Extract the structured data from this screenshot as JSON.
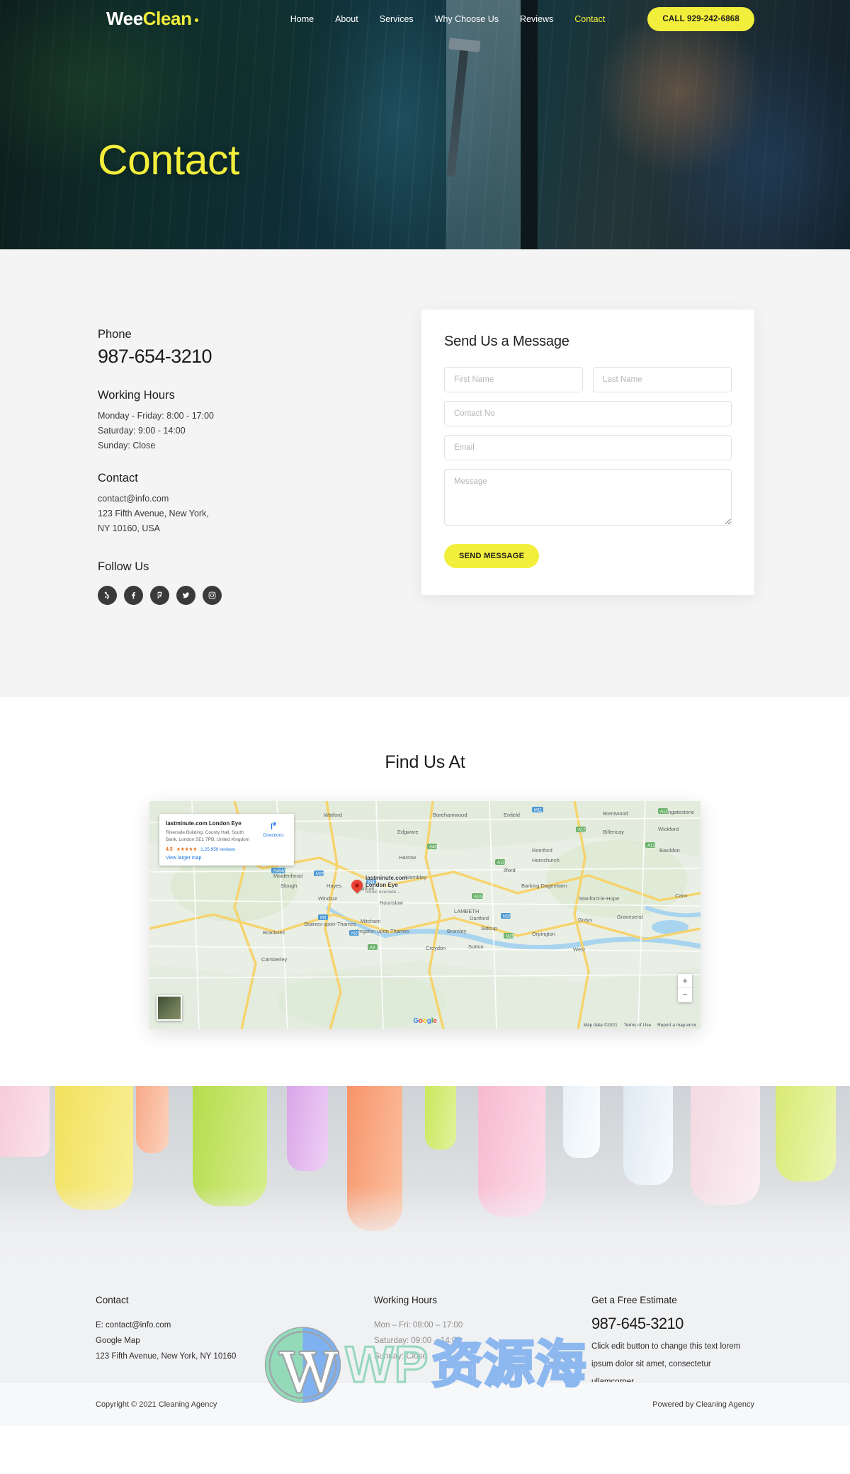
{
  "brand": {
    "name_part1": "Wee",
    "name_part2": "Clean"
  },
  "nav": {
    "items": [
      {
        "label": "Home",
        "active": false
      },
      {
        "label": "About",
        "active": false
      },
      {
        "label": "Services",
        "active": false
      },
      {
        "label": "Why Choose Us",
        "active": false
      },
      {
        "label": "Reviews",
        "active": false
      },
      {
        "label": "Contact",
        "active": true
      }
    ],
    "cta_label": "CALL 929-242-6868"
  },
  "hero": {
    "title": "Contact"
  },
  "contact": {
    "phone_label": "Phone",
    "phone_number": "987-654-3210",
    "hours_label": "Working Hours",
    "hours": [
      "Monday - Friday: 8:00 - 17:00",
      "Saturday: 9:00 - 14:00",
      "Sunday: Close"
    ],
    "contact_label": "Contact",
    "contact_lines": [
      "contact@info.com",
      "123 Fifth Avenue, New York,",
      "NY 10160, USA"
    ],
    "follow_label": "Follow Us",
    "socials": [
      {
        "name": "yelp-icon"
      },
      {
        "name": "facebook-icon"
      },
      {
        "name": "foursquare-icon"
      },
      {
        "name": "twitter-icon"
      },
      {
        "name": "instagram-icon"
      }
    ]
  },
  "form": {
    "title": "Send Us a Message",
    "first_name_placeholder": "First Name",
    "last_name_placeholder": "Last Name",
    "contact_no_placeholder": "Contact No",
    "email_placeholder": "Email",
    "message_placeholder": "Message",
    "first_name_value": "",
    "last_name_value": "",
    "contact_no_value": "",
    "email_value": "",
    "message_value": "",
    "submit_label": "SEND MESSAGE"
  },
  "map": {
    "heading": "Find Us At",
    "card_title": "lastminute.com London Eye",
    "card_address": "Riverside Building, County Hall, South Bank, London SE1 7PB, United Kingdom",
    "rating": "4.5",
    "stars": "★★★★★",
    "reviews": "1,25,959 reviews",
    "view_larger": "View larger map",
    "directions_label": "Directions",
    "marker_title_line1": "lastminute.com",
    "marker_title_line2": "London Eye",
    "marker_subtitle": "Iconic riverside…",
    "zoom_in": "+",
    "zoom_out": "−",
    "attribution": [
      "Map data ©2021",
      "Terms of Use",
      "Report a map error"
    ],
    "google_letters": [
      "G",
      "o",
      "o",
      "g",
      "l",
      "e"
    ]
  },
  "footer": {
    "col1": {
      "heading": "Contact",
      "lines": [
        "E: contact@info.com",
        "Google Map",
        "123 Fifth Avenue, New York, NY 10160"
      ]
    },
    "col2": {
      "heading": "Working Hours",
      "lines": [
        "Mon – Fri: 08:00 – 17:00",
        "Saturday: 09:00 – 14:00",
        "Sunday: Close"
      ]
    },
    "col3": {
      "heading": "Get a Free Estimate",
      "phone": "987-645-3210",
      "text": "Click edit button to change this text lorem ipsum dolor sit amet, consectetur ullamcorper."
    },
    "copyright": "Copyright © 2021 Cleaning Agency",
    "powered_by": "Powered by Cleaning Agency"
  },
  "watermark": {
    "wp": "WP",
    "cn": "资源海"
  },
  "colors": {
    "accent_yellow": "#f2ee3c",
    "dark": "#1e1e1e",
    "section_bg": "#f4f4f4"
  }
}
